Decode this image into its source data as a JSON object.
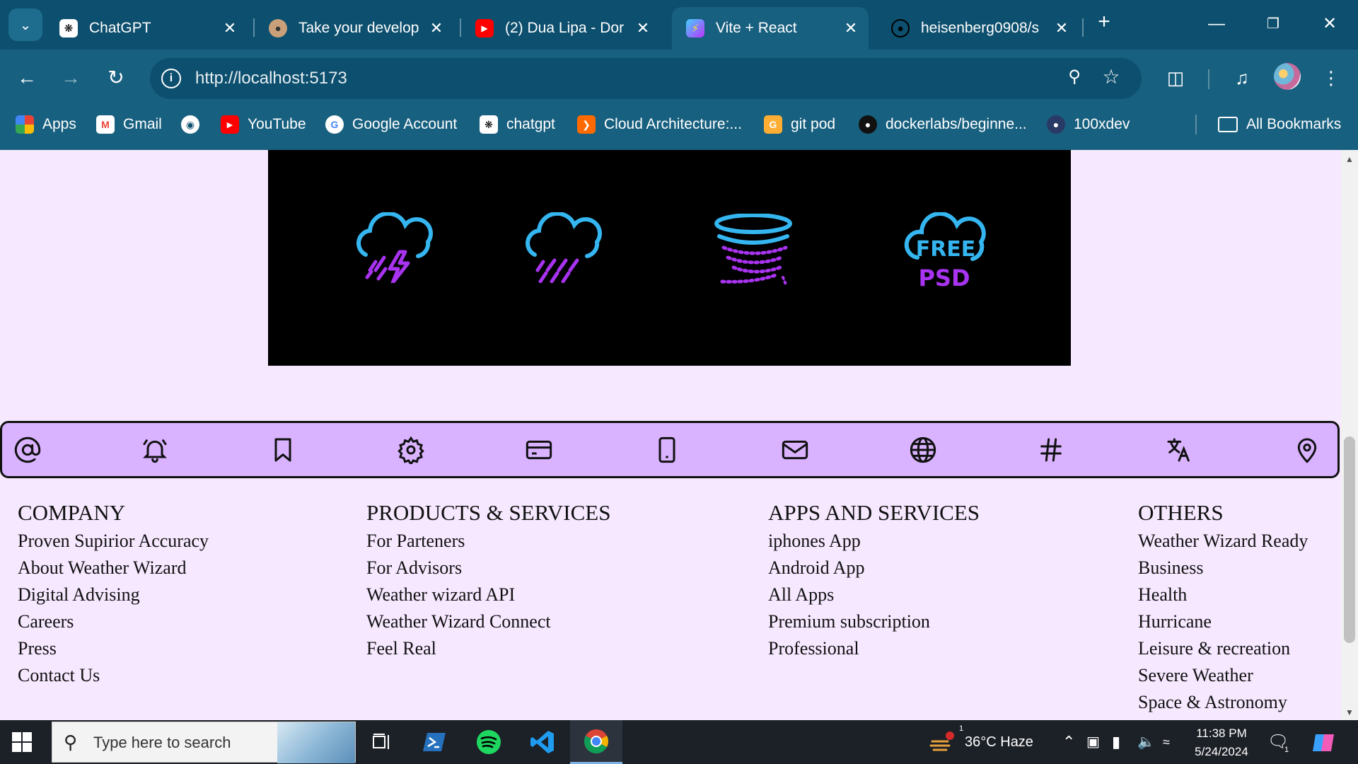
{
  "browser": {
    "tabs": [
      {
        "title": "ChatGPT",
        "icon": "chatgpt-icon",
        "active": false
      },
      {
        "title": "Take your develop",
        "icon": "avatar-icon",
        "active": false
      },
      {
        "title": "(2) Dua Lipa - Dor",
        "icon": "youtube-icon",
        "active": false
      },
      {
        "title": "Vite + React",
        "icon": "vite-icon",
        "active": true
      },
      {
        "title": "heisenberg0908/s",
        "icon": "github-icon",
        "active": false
      }
    ],
    "url": "http://localhost:5173",
    "bookmarks": [
      {
        "label": "Apps",
        "icon": "apps-grid-icon"
      },
      {
        "label": "Gmail",
        "icon": "gmail-icon"
      },
      {
        "label": "",
        "icon": "globe-icon"
      },
      {
        "label": "YouTube",
        "icon": "youtube-icon"
      },
      {
        "label": "Google Account",
        "icon": "google-icon"
      },
      {
        "label": "chatgpt",
        "icon": "chatgpt-icon"
      },
      {
        "label": "Cloud Architecture:...",
        "icon": "cloud-arch-icon"
      },
      {
        "label": "git pod",
        "icon": "gitpod-icon"
      },
      {
        "label": "dockerlabs/beginne...",
        "icon": "github-icon"
      },
      {
        "label": "100xdev",
        "icon": "avatar-icon"
      }
    ],
    "all_bookmarks": "All Bookmarks"
  },
  "page": {
    "banner": {
      "icons": [
        "thunderstorm-icon",
        "heavy-rain-icon",
        "tornado-icon",
        "free-psd-cloud-icon"
      ],
      "free_text": "FREE",
      "psd_text": "PSD"
    },
    "iconbar": [
      "at-sign-icon",
      "bell-icon",
      "bookmark-icon",
      "settings-icon",
      "credit-card-icon",
      "smartphone-icon",
      "mail-icon",
      "globe-icon",
      "hash-icon",
      "translate-icon",
      "map-pin-icon"
    ],
    "footer": {
      "columns": [
        {
          "heading": "COMPANY",
          "items": [
            "Proven Supirior Accuracy",
            "About Weather Wizard",
            "Digital Advising",
            "Careers",
            "Press",
            "Contact Us"
          ]
        },
        {
          "heading": "PRODUCTS & SERVICES",
          "items": [
            "For Parteners",
            "For Advisors",
            "Weather wizard API",
            "Weather Wizard Connect",
            "Feel Real"
          ]
        },
        {
          "heading": "APPS AND SERVICES",
          "items": [
            "iphones App",
            "Android App",
            "All Apps",
            "Premium subscription",
            "Professional"
          ]
        },
        {
          "heading": "OTHERS",
          "items": [
            "Weather Wizard Ready",
            "Business",
            "Health",
            "Hurricane",
            "Leisure & recreation",
            "Severe Weather",
            "Space & Astronomy"
          ]
        }
      ]
    }
  },
  "taskbar": {
    "search_placeholder": "Type here to search",
    "weather": "36°C  Haze",
    "weather_badge": "1",
    "time": "11:38 PM",
    "date": "5/24/2024",
    "notification_count": "1",
    "pinned": [
      "task-view-icon",
      "powershell-icon",
      "spotify-icon",
      "vscode-icon",
      "chrome-icon"
    ]
  },
  "colors": {
    "chrome_dark": "#0d4f6e",
    "chrome": "#18607f",
    "page_bg": "#f6e8ff",
    "iconbar_bg": "#d9b3ff",
    "weather_cyan": "#35b6f0",
    "weather_purple": "#a833f0"
  }
}
